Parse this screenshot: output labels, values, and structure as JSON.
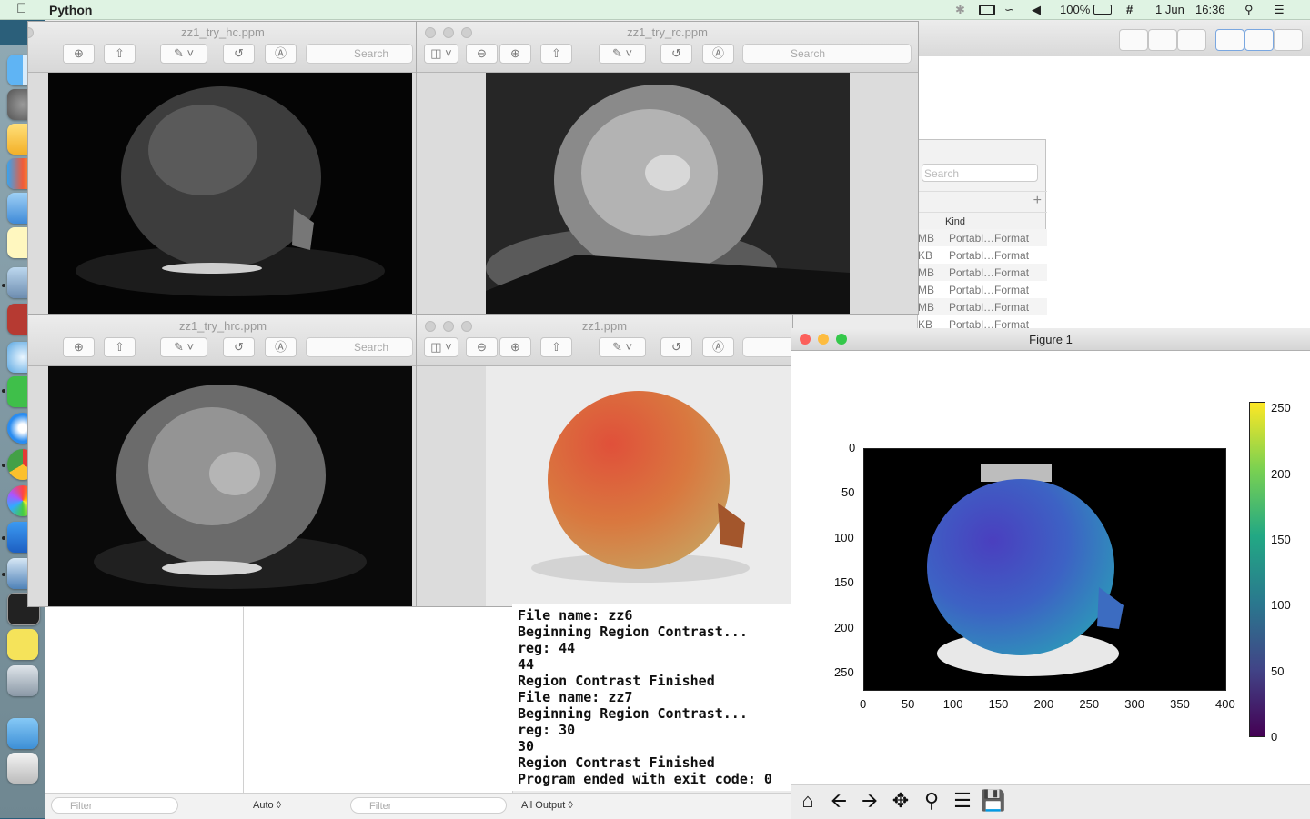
{
  "menubar": {
    "app_name": "Python",
    "battery": "100%",
    "date": "1 Jun",
    "time": "16:36"
  },
  "windows": {
    "w1_title": "zz1_try_hc.ppm",
    "w2_title": "zz1_try_rc.ppm",
    "w3_title": "zz1_try_hrc.ppm",
    "w4_title": "zz1.ppm",
    "search_placeholder": "Search"
  },
  "finder": {
    "search_placeholder": "Search",
    "column_kind": "Kind",
    "rows": [
      {
        "size": "MB",
        "kind": "Portabl…Format"
      },
      {
        "size": "KB",
        "kind": "Portabl…Format"
      },
      {
        "size": "MB",
        "kind": "Portabl…Format"
      },
      {
        "size": "MB",
        "kind": "Portabl…Format"
      },
      {
        "size": "MB",
        "kind": "Portabl…Format"
      },
      {
        "size": "KB",
        "kind": "Portabl…Format"
      }
    ]
  },
  "console": {
    "lines": [
      "File name: zz6",
      "Beginning Region Contrast...",
      "reg: 44",
      "44",
      "Region Contrast Finished",
      "File name: zz7",
      "Beginning Region Contrast...",
      "reg: 30",
      "30",
      "Region Contrast Finished",
      "Program ended with exit code: 0"
    ]
  },
  "bottom_bar": {
    "filter_placeholder": "Filter",
    "auto_label": "Auto ◊",
    "output_label": "All Output ◊"
  },
  "figure": {
    "title": "Figure 1",
    "y_ticks": [
      "0",
      "50",
      "100",
      "150",
      "200",
      "250"
    ],
    "x_ticks": [
      "0",
      "50",
      "100",
      "150",
      "200",
      "250",
      "300",
      "350",
      "400"
    ],
    "colorbar_ticks": [
      "250",
      "200",
      "150",
      "100",
      "50",
      "0"
    ]
  },
  "chart_data": {
    "type": "heatmap",
    "xlim": [
      0,
      400
    ],
    "ylim": [
      270,
      0
    ],
    "colorbar_range": [
      0,
      255
    ],
    "colormap": "viridis"
  }
}
